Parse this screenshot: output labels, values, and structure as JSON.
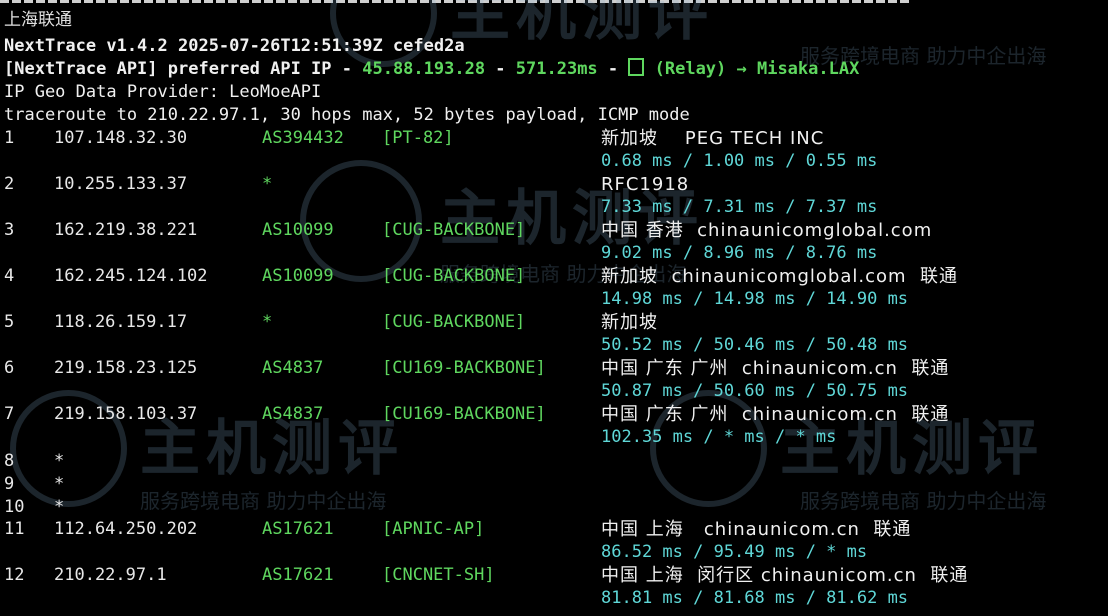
{
  "header": {
    "window_title": "上海联通",
    "version_line": "NextTrace v1.4.2 2025-07-26T12:51:39Z cefed2a",
    "api_prefix": "[NextTrace API] preferred API IP - ",
    "api_ip": "45.88.193.28",
    "api_sep1": " - ",
    "api_latency": "571.23ms",
    "api_sep2": " - ",
    "api_relay": " (Relay) → Misaka.LAX",
    "geo_provider_line": "IP Geo Data Provider: LeoMoeAPI",
    "traceroute_line": "traceroute to 210.22.97.1, 30 hops max, 52 bytes payload, ICMP mode"
  },
  "watermark": {
    "word": "主机测评",
    "sub": "服务跨境电商 助力中企出海",
    "logo": "globe-logo"
  },
  "hops": [
    {
      "n": "1",
      "ip": "107.148.32.30",
      "asn": "AS394432",
      "tag": "[PT-82]",
      "geo": "新加坡    PEG TECH INC",
      "rtt": "0.68 ms / 1.00 ms / 0.55 ms"
    },
    {
      "n": "2",
      "ip": "10.255.133.37",
      "asn": "*",
      "tag": "",
      "geo": "RFC1918",
      "rtt": "7.33 ms / 7.31 ms / 7.37 ms"
    },
    {
      "n": "3",
      "ip": "162.219.38.221",
      "asn": "AS10099",
      "tag": "[CUG-BACKBONE]",
      "geo": "中国 香港  chinaunicomglobal.com",
      "rtt": "9.02 ms / 8.96 ms / 8.76 ms"
    },
    {
      "n": "4",
      "ip": "162.245.124.102",
      "asn": "AS10099",
      "tag": "[CUG-BACKBONE]",
      "geo": "新加坡  chinaunicomglobal.com  联通",
      "rtt": "14.98 ms / 14.98 ms / 14.90 ms"
    },
    {
      "n": "5",
      "ip": "118.26.159.17",
      "asn": "*",
      "tag": "[CUG-BACKBONE]",
      "geo": "新加坡",
      "rtt": "50.52 ms / 50.46 ms / 50.48 ms"
    },
    {
      "n": "6",
      "ip": "219.158.23.125",
      "asn": "AS4837",
      "tag": "[CU169-BACKBONE]",
      "geo": "中国 广东 广州  chinaunicom.cn  联通",
      "rtt": "50.87 ms / 50.60 ms / 50.75 ms"
    },
    {
      "n": "7",
      "ip": "219.158.103.37",
      "asn": "AS4837",
      "tag": "[CU169-BACKBONE]",
      "geo": "中国 广东 广州  chinaunicom.cn  联通",
      "rtt": "102.35 ms / * ms / * ms"
    },
    {
      "n": "8",
      "ip": "*",
      "asn": "",
      "tag": "",
      "geo": "",
      "rtt": ""
    },
    {
      "n": "9",
      "ip": "*",
      "asn": "",
      "tag": "",
      "geo": "",
      "rtt": ""
    },
    {
      "n": "10",
      "ip": "*",
      "asn": "",
      "tag": "",
      "geo": "",
      "rtt": ""
    },
    {
      "n": "11",
      "ip": "112.64.250.202",
      "asn": "AS17621",
      "tag": "[APNIC-AP]",
      "geo": "中国 上海   chinaunicom.cn  联通",
      "rtt": "86.52 ms / 95.49 ms / * ms"
    },
    {
      "n": "12",
      "ip": "210.22.97.1",
      "asn": "AS17621",
      "tag": "[CNCNET-SH]",
      "geo": "中国 上海  闵行区 chinaunicom.cn  联通",
      "rtt": "81.81 ms / 81.68 ms / 81.62 ms"
    }
  ],
  "colors": {
    "background": "#000000",
    "green": "#5fd75f",
    "cyan": "#5fd7d7",
    "text": "#e8e8e8"
  }
}
